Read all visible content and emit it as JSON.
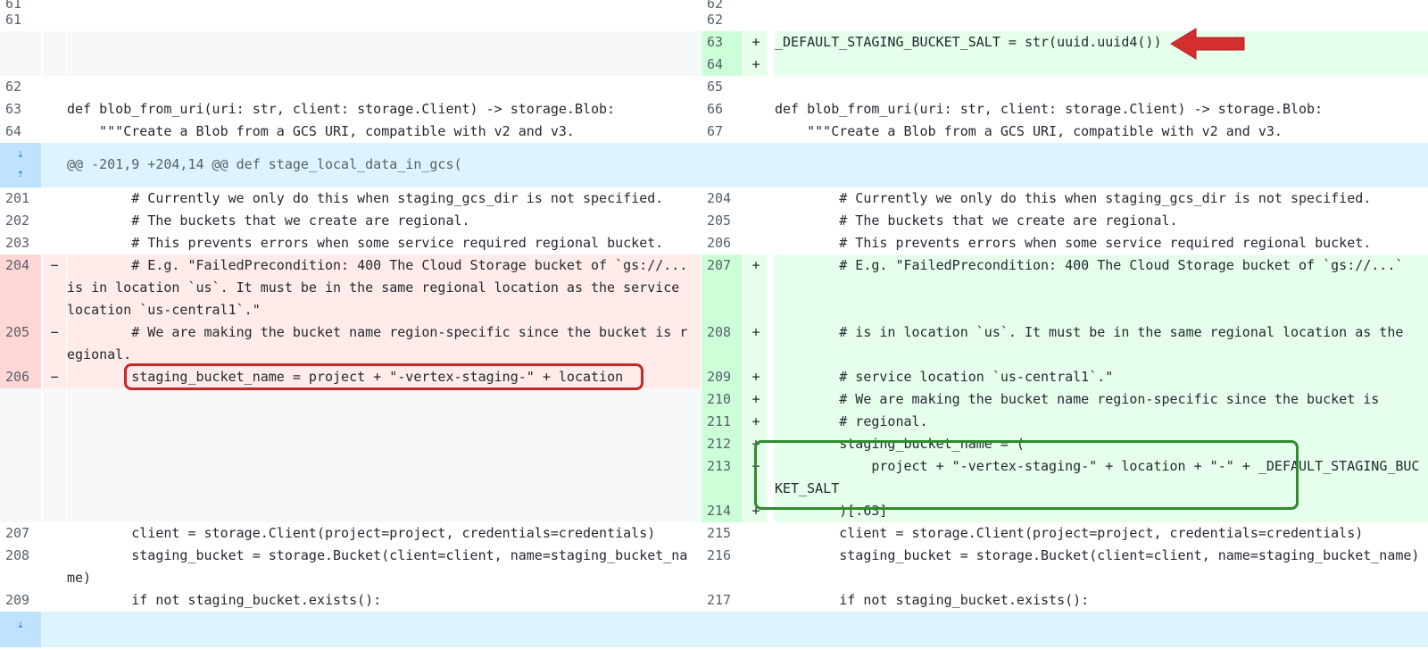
{
  "hunk_header": "@@ -201,9 +204,14 @@ def stage_local_data_in_gcs(",
  "rows": [
    {
      "h": 18,
      "kind": "ctx",
      "lnum": "61",
      "rnum": "62",
      "ltext": "",
      "rtext": ""
    },
    {
      "h": 25,
      "kind": "ctx",
      "lnum": "61",
      "rnum": "62",
      "ltext": "",
      "rtext": ""
    },
    {
      "h": 25,
      "kind": "add",
      "lnum": "",
      "rnum": "63",
      "ltext": "",
      "rtext": "_DEFAULT_STAGING_BUCKET_SALT = str(uuid.uuid4())"
    },
    {
      "h": 25,
      "kind": "add",
      "lnum": "",
      "rnum": "64",
      "ltext": "",
      "rtext": ""
    },
    {
      "h": 25,
      "kind": "ctx",
      "lnum": "62",
      "rnum": "65",
      "ltext": "",
      "rtext": ""
    },
    {
      "h": 25,
      "kind": "ctx",
      "lnum": "63",
      "rnum": "66",
      "ltext": "def blob_from_uri(uri: str, client: storage.Client) -> storage.Blob:",
      "rtext": "def blob_from_uri(uri: str, client: storage.Client) -> storage.Blob:"
    },
    {
      "h": 25,
      "kind": "ctx",
      "lnum": "64",
      "rnum": "67",
      "ltext": "    \"\"\"Create a Blob from a GCS URI, compatible with v2 and v3.",
      "rtext": "    \"\"\"Create a Blob from a GCS URI, compatible with v2 and v3."
    },
    {
      "h": 50,
      "kind": "hunk"
    },
    {
      "h": 25,
      "kind": "ctx",
      "lnum": "201",
      "rnum": "204",
      "ltext": "        # Currently we only do this when staging_gcs_dir is not specified.",
      "rtext": "        # Currently we only do this when staging_gcs_dir is not specified."
    },
    {
      "h": 25,
      "kind": "ctx",
      "lnum": "202",
      "rnum": "205",
      "ltext": "        # The buckets that we create are regional.",
      "rtext": "        # The buckets that we create are regional."
    },
    {
      "h": 25,
      "kind": "ctx",
      "lnum": "203",
      "rnum": "206",
      "ltext": "        # This prevents errors when some service required regional bucket.",
      "rtext": "        # This prevents errors when some service required regional bucket."
    },
    {
      "h": 75,
      "kind": "chg",
      "lnum": "204",
      "rnum": "207",
      "ltext": "        # E.g. \"FailedPrecondition: 400 The Cloud Storage bucket of `gs://... is in location `us`. It must be in the same regional location as the service location `us-central1`.\"",
      "rtext": "        # E.g. \"FailedPrecondition: 400 The Cloud Storage bucket of `gs://...`"
    },
    {
      "h": 50,
      "kind": "chg",
      "lnum": "205",
      "rnum": "208",
      "ltext": "        # We are making the bucket name region-specific since the bucket is regional.",
      "rtext": "        # is in location `us`. It must be in the same regional location as the"
    },
    {
      "h": 25,
      "kind": "chg",
      "lnum": "206",
      "rnum": "209",
      "ltext": "        staging_bucket_name = project + \"-vertex-staging-\" + location",
      "rtext": "        # service location `us-central1`.\""
    },
    {
      "h": 25,
      "kind": "add",
      "lnum": "",
      "rnum": "210",
      "ltext": "",
      "rtext": "        # We are making the bucket name region-specific since the bucket is"
    },
    {
      "h": 25,
      "kind": "add",
      "lnum": "",
      "rnum": "211",
      "ltext": "",
      "rtext": "        # regional."
    },
    {
      "h": 25,
      "kind": "add",
      "lnum": "",
      "rnum": "212",
      "ltext": "",
      "rtext": "        staging_bucket_name = ("
    },
    {
      "h": 50,
      "kind": "add",
      "lnum": "",
      "rnum": "213",
      "ltext": "",
      "rtext": "            project + \"-vertex-staging-\" + location + \"-\" + _DEFAULT_STAGING_BUCKET_SALT"
    },
    {
      "h": 25,
      "kind": "add",
      "lnum": "",
      "rnum": "214",
      "ltext": "",
      "rtext": "        )[:63]"
    },
    {
      "h": 25,
      "kind": "ctx",
      "lnum": "207",
      "rnum": "215",
      "ltext": "        client = storage.Client(project=project, credentials=credentials)",
      "rtext": "        client = storage.Client(project=project, credentials=credentials)"
    },
    {
      "h": 50,
      "kind": "ctx",
      "lnum": "208",
      "rnum": "216",
      "ltext": "        staging_bucket = storage.Bucket(client=client, name=staging_bucket_name)",
      "rtext": "        staging_bucket = storage.Bucket(client=client, name=staging_bucket_name)"
    },
    {
      "h": 25,
      "kind": "ctx",
      "lnum": "209",
      "rnum": "217",
      "ltext": "        if not staging_bucket.exists():",
      "rtext": "        if not staging_bucket.exists():"
    },
    {
      "h": 40,
      "kind": "expand-bottom"
    }
  ]
}
